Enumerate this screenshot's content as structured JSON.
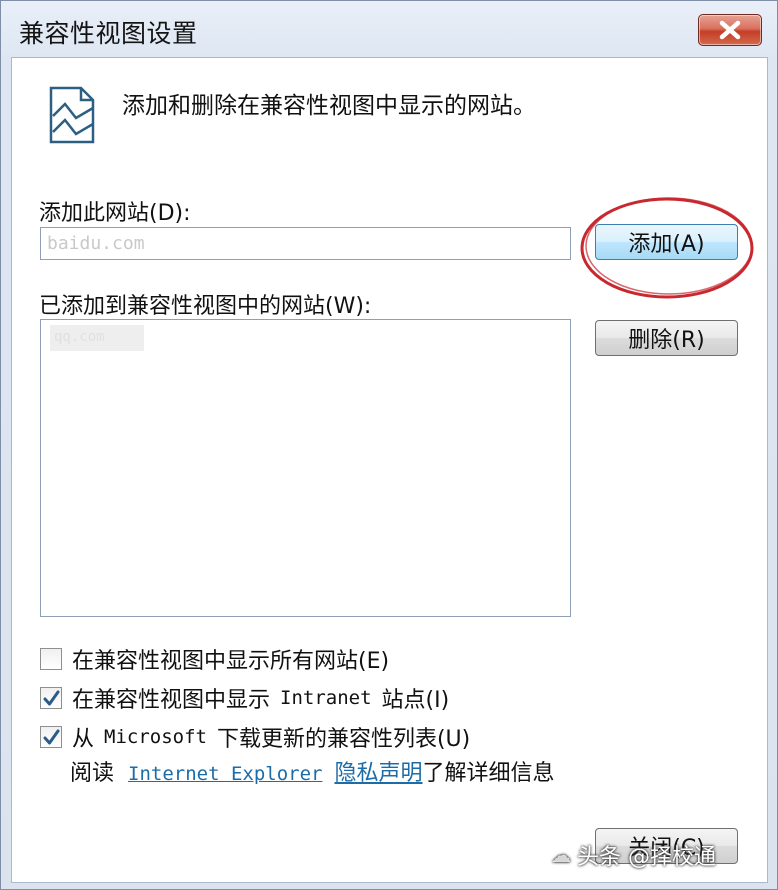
{
  "window": {
    "title": "兼容性视图设置"
  },
  "header": {
    "description": "添加和删除在兼容性视图中显示的网站。"
  },
  "add_site": {
    "label": "添加此网站(D):",
    "value": "baidu.com",
    "add_button": "添加(A)"
  },
  "site_list": {
    "label": "已添加到兼容性视图中的网站(W):",
    "items": [
      "qq.com"
    ],
    "remove_button": "删除(R)"
  },
  "options": {
    "show_all": {
      "label": "在兼容性视图中显示所有网站(E)",
      "checked": false
    },
    "intranet": {
      "label_pre": "在兼容性视图中显示",
      "label_code": "Intranet",
      "label_post": "站点(I)",
      "checked": true
    },
    "download": {
      "label_pre": "从",
      "label_code": "Microsoft",
      "label_post": "下载更新的兼容性列表(U)",
      "checked": true
    }
  },
  "privacy": {
    "prefix": "阅读",
    "link_code": "Internet Explorer",
    "link_text": "隐私声明",
    "suffix": "了解详细信息"
  },
  "footer": {
    "close_button": "关闭(C)"
  },
  "watermark": {
    "text": "头条 @择校通"
  },
  "colors": {
    "annotation": "#c8282f",
    "link": "#1d6ca8",
    "close_red": "#c53d27"
  },
  "icons": {
    "close": "close-x-icon",
    "header": "image-page-icon",
    "check": "checkmark-icon"
  }
}
